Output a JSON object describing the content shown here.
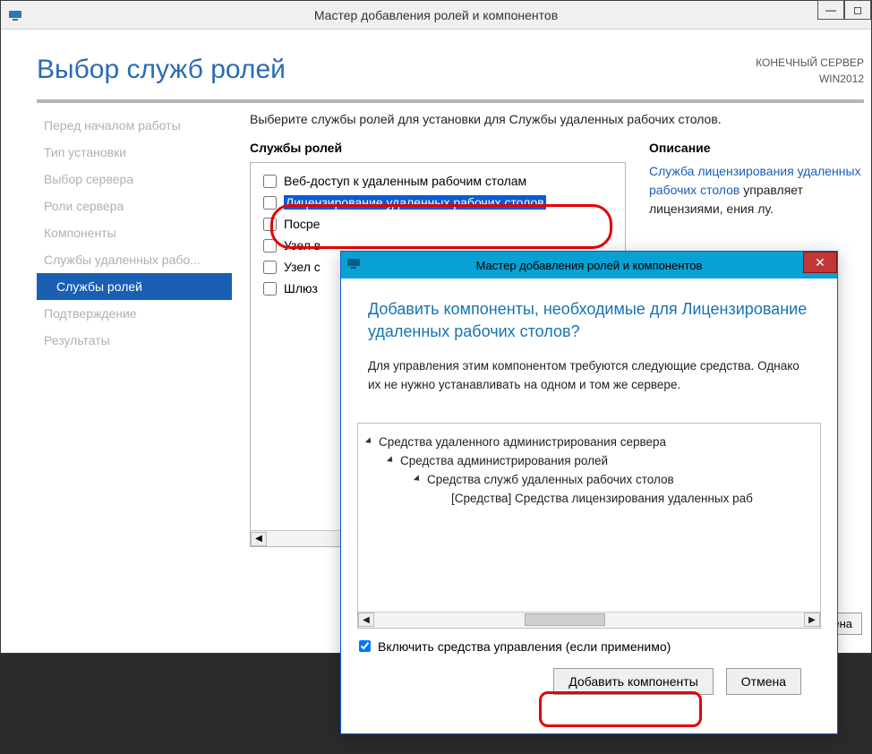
{
  "window": {
    "title": "Мастер добавления ролей и компонентов",
    "page_title": "Выбор служб ролей",
    "target_label": "КОНЕЧНЫЙ СЕРВЕР",
    "target_server": "WIN2012"
  },
  "steps": [
    "Перед началом работы",
    "Тип установки",
    "Выбор сервера",
    "Роли сервера",
    "Компоненты",
    "Службы удаленных рабо...",
    "Службы ролей",
    "Подтверждение",
    "Результаты"
  ],
  "active_step_index": 6,
  "instruction": "Выберите службы ролей для установки для Службы удаленных рабочих столов.",
  "roles_heading": "Службы ролей",
  "desc_heading": "Описание",
  "roles": [
    {
      "label": "Веб-доступ к удаленным рабочим столам",
      "checked": false
    },
    {
      "label": "Лицензирование удаленных рабочих столов",
      "checked": false,
      "highlighted": true
    },
    {
      "label": "Посре",
      "checked": false
    },
    {
      "label": "Узел в",
      "checked": false
    },
    {
      "label": "Узел с",
      "checked": false
    },
    {
      "label": "Шлюз",
      "checked": false
    }
  ],
  "description": {
    "link_part": "Служба лицензирования удаленных рабочих столов",
    "rest": " управляет лицензиями, ения лу."
  },
  "footer": {
    "cancel_fragment": "мена"
  },
  "popup": {
    "title": "Мастер добавления ролей и компонентов",
    "heading": "Добавить компоненты, необходимые для Лицензирование удаленных рабочих столов?",
    "text": "Для управления этим компонентом требуются следующие средства. Однако их не нужно устанавливать на одном и том же сервере.",
    "tree": [
      {
        "indent": 0,
        "label": "Средства удаленного администрирования сервера"
      },
      {
        "indent": 1,
        "label": "Средства администрирования ролей"
      },
      {
        "indent": 2,
        "label": "Средства служб удаленных рабочих столов"
      },
      {
        "indent": 3,
        "label": "[Средства] Средства лицензирования удаленных раб"
      }
    ],
    "include_mgmt_label": "Включить средства управления (если применимо)",
    "include_mgmt_checked": true,
    "add_button": "Добавить компоненты",
    "cancel_button": "Отмена"
  }
}
